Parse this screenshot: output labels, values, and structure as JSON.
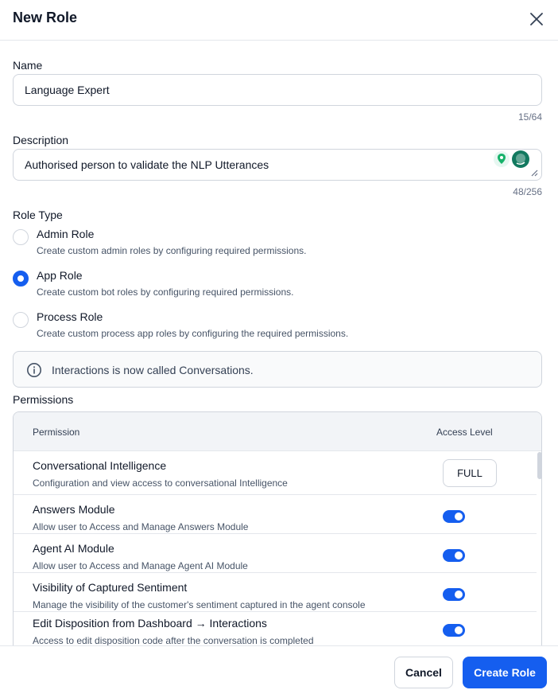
{
  "header": {
    "title": "New Role"
  },
  "name_field": {
    "label": "Name",
    "value": "Language Expert",
    "counter": "15/64"
  },
  "description_field": {
    "label": "Description",
    "value": "Authorised person to validate the NLP Utterances",
    "counter": "48/256"
  },
  "role_type": {
    "label": "Role Type",
    "options": [
      {
        "title": "Admin Role",
        "desc": "Create custom admin roles by configuring required permissions.",
        "selected": false
      },
      {
        "title": "App Role",
        "desc": "Create custom bot roles by configuring required permissions.",
        "selected": true
      },
      {
        "title": "Process Role",
        "desc": "Create custom process app roles by configuring the required permissions.",
        "selected": false
      }
    ]
  },
  "info": {
    "text": "Interactions is now called Conversations."
  },
  "permissions": {
    "label": "Permissions",
    "col_permission": "Permission",
    "col_access": "Access Level",
    "rows": [
      {
        "title": "Conversational Intelligence",
        "desc": "Configuration and view access to conversational Intelligence",
        "access": "FULL"
      },
      {
        "title": "Answers Module",
        "desc": "Allow user to Access and Manage Answers Module",
        "enabled": true
      },
      {
        "title": "Agent AI Module",
        "desc": "Allow user to Access and Manage Agent AI Module",
        "enabled": true
      },
      {
        "title": "Visibility of Captured Sentiment",
        "desc": "Manage the visibility of the customer's sentiment captured in the agent console",
        "enabled": true
      },
      {
        "title": "Edit Disposition from Dashboard → Interactions",
        "desc": "Access to edit disposition code after the conversation is completed",
        "enabled": true
      }
    ]
  },
  "footer": {
    "cancel_label": "Cancel",
    "create_label": "Create Role"
  },
  "colors": {
    "accent": "#155eef",
    "border": "#d0d5dd",
    "text": "#101828",
    "muted": "#475467"
  },
  "icons": {
    "close": "close-icon",
    "info": "info-icon",
    "resize": "resize-handle-icon"
  }
}
